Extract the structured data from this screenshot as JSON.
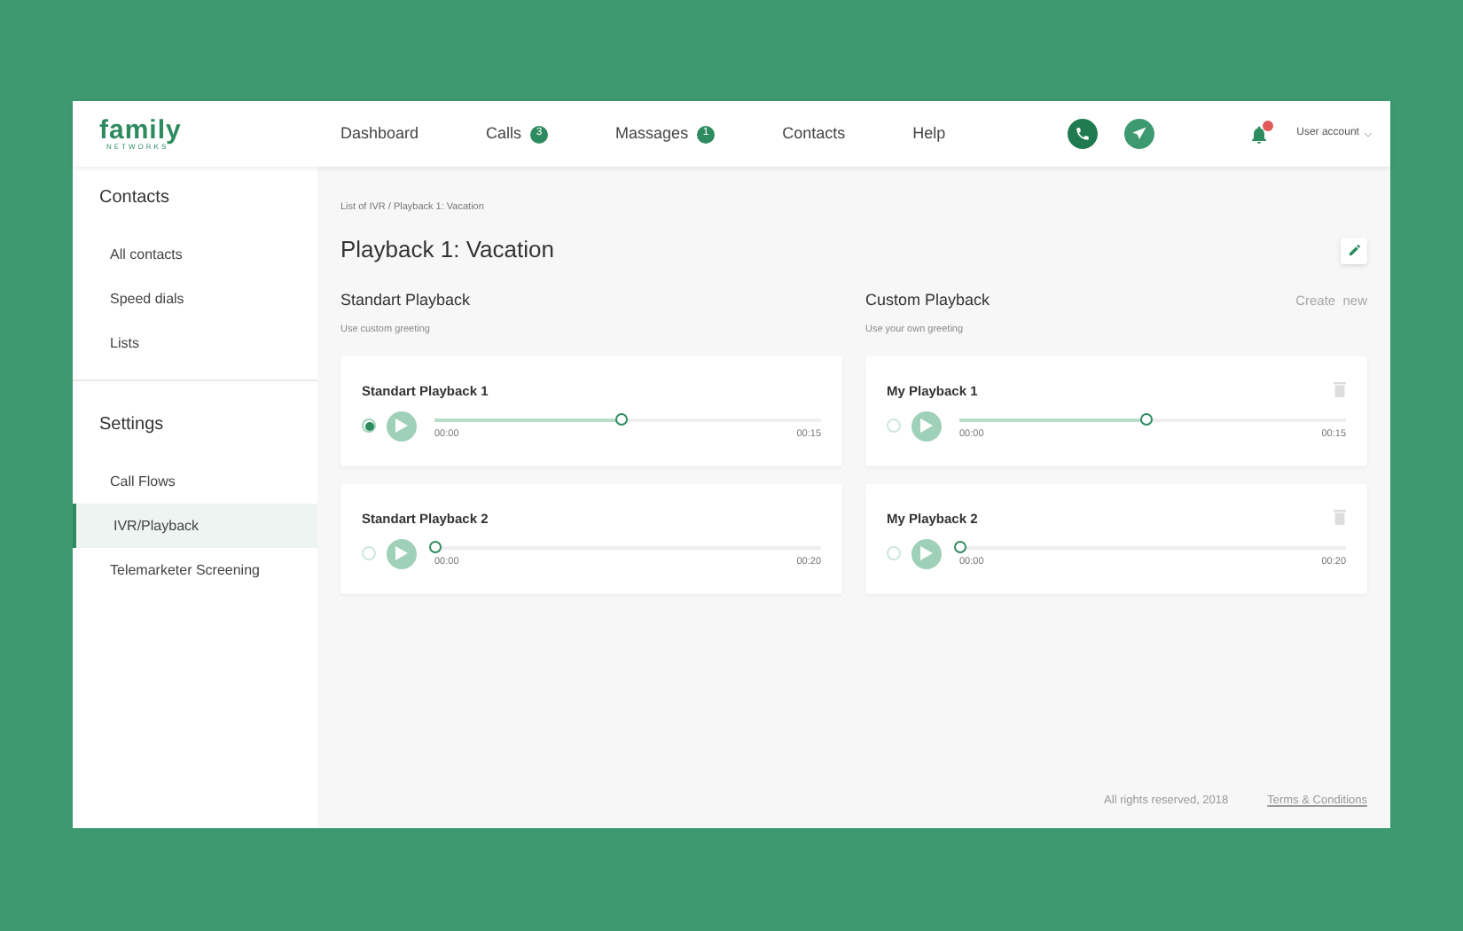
{
  "logo": {
    "name": "family",
    "sub": "NETWORKS"
  },
  "nav": [
    {
      "label": "Dashboard"
    },
    {
      "label": "Calls",
      "badge": "3"
    },
    {
      "label": "Massages",
      "badge": "1"
    },
    {
      "label": "Contacts"
    },
    {
      "label": "Help"
    }
  ],
  "notifications": {
    "unread": true
  },
  "user_menu": "User account",
  "sidebar": [
    {
      "heading": "Contacts",
      "items": [
        {
          "label": "All contacts",
          "selected": false
        },
        {
          "label": "Speed dials",
          "selected": false
        },
        {
          "label": "Lists",
          "selected": false
        }
      ]
    },
    {
      "heading": "Settings",
      "items": [
        {
          "label": "Call Flows",
          "selected": false
        },
        {
          "label": "IVR/Playback",
          "selected": true
        },
        {
          "label": "Telemarketer Screening",
          "selected": false
        }
      ]
    }
  ],
  "breadcrumb": "List of IVR / Playback 1: Vacation",
  "title": "Playback 1: Vacation",
  "sections": [
    {
      "title": "Standart Playback",
      "subtitle": "Use custom greeting",
      "deletable": false,
      "items": [
        {
          "name": "Standart Playback 1",
          "selected": true,
          "level": 0.48,
          "start": "00:00",
          "end": "00:15"
        },
        {
          "name": "Standart Playback 2",
          "selected": false,
          "level": 0,
          "start": "00:00",
          "end": "00:20"
        }
      ]
    },
    {
      "title": "Custom Playback",
      "subtitle": "Use your own greeting",
      "action": "Create  new",
      "deletable": true,
      "items": [
        {
          "name": "My Playback 1",
          "selected": false,
          "level": 0.48,
          "start": "00:00",
          "end": "00:15"
        },
        {
          "name": "My Playback 2",
          "selected": false,
          "level": 0,
          "start": "00:00",
          "end": "00:20"
        }
      ]
    }
  ],
  "footer": {
    "copyright": "All rights reserved, 2018",
    "link": "Terms & Conditions"
  }
}
